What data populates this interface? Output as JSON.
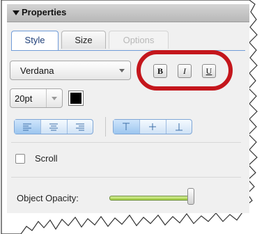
{
  "panel": {
    "title": "Properties"
  },
  "tabs": [
    {
      "label": "Style",
      "state": "active"
    },
    {
      "label": "Size",
      "state": "normal"
    },
    {
      "label": "Options",
      "state": "disabled"
    }
  ],
  "font": {
    "family_value": "Verdana"
  },
  "text_style_buttons": {
    "bold": "B",
    "italic": "I",
    "underline": "U"
  },
  "font_size": {
    "value": "20pt"
  },
  "text_color": {
    "value": "#000000"
  },
  "horizontal_alignment": {
    "options": [
      "left",
      "center",
      "right"
    ],
    "selected": "left"
  },
  "vertical_alignment": {
    "options": [
      "top",
      "middle",
      "bottom"
    ],
    "selected": "top"
  },
  "scroll": {
    "label": "Scroll",
    "checked": false
  },
  "opacity": {
    "label": "Object Opacity:",
    "level": 1.0
  },
  "colors": {
    "highlight_ring": "#c4161c",
    "accent": "#6f9bd8",
    "slider_fill": "#9fcb3e"
  }
}
